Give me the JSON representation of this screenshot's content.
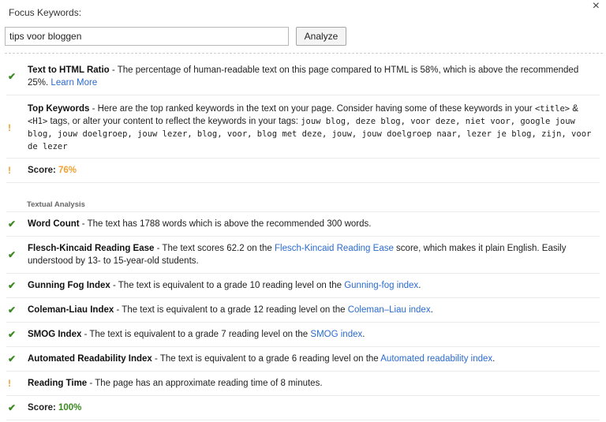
{
  "header": {
    "focus_label": "Focus Keywords:",
    "input_value": "tips voor bloggen",
    "analyze_label": "Analyze",
    "close_glyph": "×"
  },
  "overview": {
    "html_ratio": {
      "title": "Text to HTML Ratio",
      "text": " - The percentage of human-readable text on this page compared to HTML is 58%, which is above the recommended 25%. ",
      "link": "Learn More"
    },
    "top_keywords": {
      "title": "Top Keywords",
      "text": " - Here are the top ranked keywords in the text on your page. Consider having some of these keywords in your ",
      "tag_title": "<title>",
      "amp": " & ",
      "tag_h1": "<H1>",
      "text2": " tags, or alter your content to reflect the keywords in your tags: ",
      "keywords": "jouw blog, deze blog, voor deze, niet voor, google jouw blog, jouw doelgroep, jouw lezer, blog, voor, blog met deze, jouw, jouw doelgroep naar, lezer je blog, zijn, voor de lezer"
    },
    "score": {
      "label": "Score: ",
      "value": "76%"
    }
  },
  "textual": {
    "section_label": "Textual Analysis",
    "word_count": {
      "title": "Word Count",
      "text": " - The text has 1788 words which is above the recommended 300 words."
    },
    "flesch": {
      "title": "Flesch-Kincaid Reading Ease",
      "text": " - The text scores 62.2 on the ",
      "link": "Flesch-Kincaid Reading Ease",
      "text2": " score, which makes it plain English. Easily understood by 13- to 15-year-old students."
    },
    "gunning": {
      "title": "Gunning Fog Index",
      "text": " - The text is equivalent to a grade 10 reading level on the ",
      "link": "Gunning-fog index",
      "end": "."
    },
    "coleman": {
      "title": "Coleman-Liau Index",
      "text": " - The text is equivalent to a grade 12 reading level on the ",
      "link": "Coleman–Liau index",
      "end": "."
    },
    "smog": {
      "title": "SMOG Index",
      "text": " - The text is equivalent to a grade 7 reading level on the ",
      "link": "SMOG index",
      "end": "."
    },
    "ari": {
      "title": "Automated Readability Index",
      "text": " - The text is equivalent to a grade 6 reading level on the ",
      "link": "Automated readability index",
      "end": "."
    },
    "reading_time": {
      "title": "Reading Time",
      "text": " - The page has an approximate reading time of 8 minutes."
    },
    "score": {
      "label": "Score: ",
      "value": "100%"
    }
  },
  "icons": {
    "ok": "✔",
    "warn": "!"
  },
  "colors": {
    "ok": "#3a8a1f",
    "warn": "#f0a030",
    "link": "#2a6bd0"
  }
}
